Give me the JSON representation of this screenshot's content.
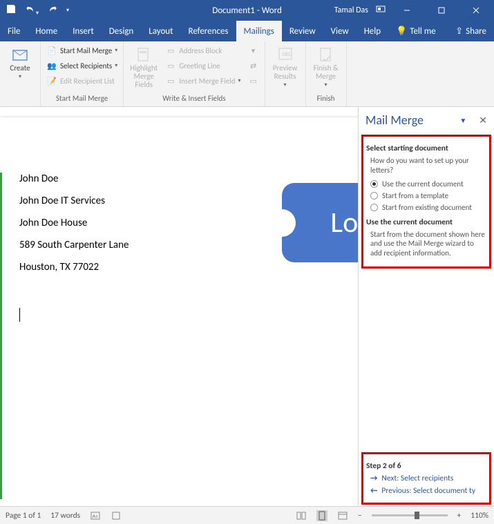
{
  "titlebar": {
    "document_title": "Document1 - Word",
    "user": "Tamal Das"
  },
  "tabs": {
    "file": "File",
    "home": "Home",
    "insert": "Insert",
    "design": "Design",
    "layout": "Layout",
    "references": "References",
    "mailings": "Mailings",
    "review": "Review",
    "view": "View",
    "help": "Help",
    "tell_me": "Tell me",
    "share": "Share"
  },
  "ribbon": {
    "create_group": {
      "create": "Create",
      "label": ""
    },
    "start_group": {
      "start_mail_merge": "Start Mail Merge",
      "select_recipients": "Select Recipients",
      "edit_recipient_list": "Edit Recipient List",
      "label": "Start Mail Merge"
    },
    "write_group": {
      "highlight": "Highlight Merge Fields",
      "address_block": "Address Block",
      "greeting_line": "Greeting Line",
      "insert_merge_field": "Insert Merge Field",
      "label": "Write & Insert Fields"
    },
    "preview_group": {
      "preview": "Preview Results",
      "label": ""
    },
    "finish_group": {
      "finish": "Finish & Merge",
      "label": "Finish"
    }
  },
  "document": {
    "lines": [
      "John Doe",
      "John Doe IT Services",
      "John Doe House",
      "589 South Carpenter Lane",
      "Houston, TX 77022"
    ],
    "logo_text": "Log"
  },
  "pane": {
    "title": "Mail Merge",
    "section1": {
      "heading": "Select starting document",
      "question": "How do you want to set up your letters?",
      "opt1": "Use the current document",
      "opt2": "Start from a template",
      "opt3": "Start from existing document"
    },
    "section2": {
      "heading": "Use the current document",
      "body": "Start from the document shown here and use the Mail Merge wizard to add recipient information."
    },
    "step": {
      "label": "Step 2 of 6",
      "next": "Next: Select recipients",
      "prev": "Previous: Select document ty"
    }
  },
  "statusbar": {
    "page": "Page 1 of 1",
    "words": "17 words",
    "zoom": "110%"
  }
}
